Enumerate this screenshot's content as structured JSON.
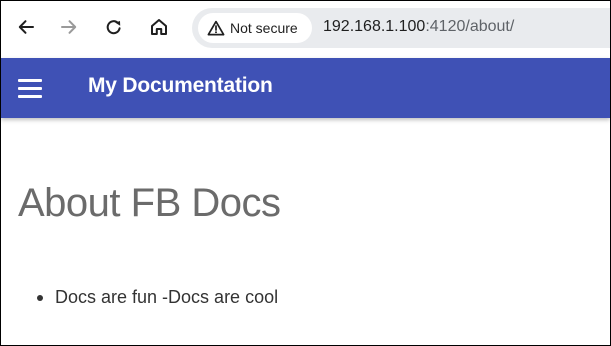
{
  "browser": {
    "security_label": "Not secure",
    "url_host": "192.168.1.100",
    "url_rest": ":4120/about/",
    "icons": {
      "back": "arrow-left-icon",
      "forward": "arrow-right-icon",
      "reload": "reload-icon",
      "home": "home-icon",
      "warning": "warning-triangle-icon"
    }
  },
  "header": {
    "title": "My Documentation",
    "background": "#3f51b5",
    "menu_icon": "hamburger-menu-icon"
  },
  "main": {
    "heading": "About FB Docs",
    "list_items": [
      "Docs are fun -Docs are cool"
    ]
  }
}
